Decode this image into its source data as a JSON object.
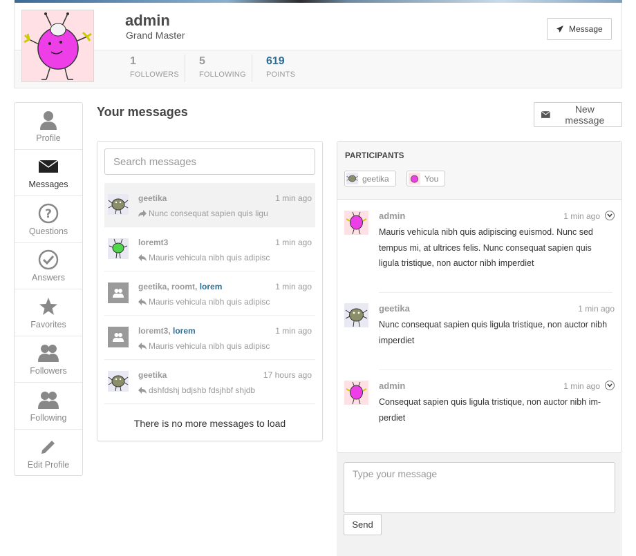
{
  "profile": {
    "name": "admin",
    "rank": "Grand Master",
    "message_button": "Message",
    "stats": [
      {
        "value": "1",
        "label": "FOLLOWERS"
      },
      {
        "value": "5",
        "label": "FOLLOWING"
      },
      {
        "value": "619",
        "label": "POINTS"
      }
    ]
  },
  "nav": {
    "items": [
      {
        "label": "Profile",
        "icon": "user-icon"
      },
      {
        "label": "Messages",
        "icon": "envelope-icon",
        "active": true
      },
      {
        "label": "Questions",
        "icon": "question-circle-icon"
      },
      {
        "label": "Answers",
        "icon": "check-circle-icon"
      },
      {
        "label": "Favorites",
        "icon": "star-icon"
      },
      {
        "label": "Followers",
        "icon": "users-icon"
      },
      {
        "label": "Following",
        "icon": "users-icon"
      },
      {
        "label": "Edit Profile",
        "icon": "pencil-icon"
      }
    ]
  },
  "messages": {
    "title": "Your messages",
    "new_message_button": "New message",
    "search_placeholder": "Search messages",
    "no_more": "There is no more messages to load",
    "conversations": [
      {
        "name": "geetika",
        "time": "1 min ago",
        "snippet": "Nunc consequat sapien quis ligu",
        "direction": "forward-icon",
        "avatar": "monster-grey"
      },
      {
        "name": "loremt3",
        "time": "1 min ago",
        "snippet": "Mauris vehicula nibh quis adipisc",
        "direction": "reply-icon",
        "avatar": "monster-green"
      },
      {
        "name_parts": [
          "geetika, ",
          "roomt, ",
          "lorem"
        ],
        "time": "1 min ago",
        "snippet": "Mauris vehicula nibh quis adipisc",
        "direction": "reply-icon",
        "avatar": "group"
      },
      {
        "name_parts": [
          "loremt3, ",
          "lorem"
        ],
        "time": "1 min ago",
        "snippet": "Mauris vehicula nibh quis adipisc",
        "direction": "reply-icon",
        "avatar": "group"
      },
      {
        "name": "geetika",
        "time": "17 hours ago",
        "snippet": "dshfdshj bdjshb fdsjhbf shjdb",
        "direction": "reply-icon",
        "avatar": "monster-grey"
      }
    ]
  },
  "thread": {
    "participants_title": "PARTICIPANTS",
    "participants": [
      "geetika",
      "You"
    ],
    "messages": [
      {
        "author": "admin",
        "time": "1 min ago",
        "body": "Mauris vehicula nibh quis adipiscing euismod. Nunc sed tempus mi, at ultrices felis. Nunc consequat sapien quis ligula tristique, non auctor nibh imperdiet"
      },
      {
        "author": "geetika",
        "time": "1 min ago",
        "body": "Nunc consequat sapien quis ligula tristique, non auctor nibh imperdiet"
      },
      {
        "author": "admin",
        "time": "1 min ago",
        "body": "Consequat sapien quis ligula tristique, non auctor nibh im-perdiet"
      }
    ],
    "reply_placeholder": "Type your message",
    "send_button": "Send"
  },
  "colors": {
    "accent": "#2a6f97",
    "muted": "#999999",
    "avatar_pink": "#ffe0e5",
    "monster_magenta": "#e83ee0"
  }
}
